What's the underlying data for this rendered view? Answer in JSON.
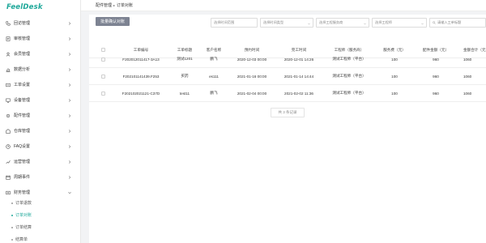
{
  "app": {
    "logo": "FeelDesk"
  },
  "sidebar": {
    "items": [
      {
        "label": "回访管理",
        "icon": "phone-icon"
      },
      {
        "label": "审核管理",
        "icon": "audit-icon"
      },
      {
        "label": "会员管理",
        "icon": "member-icon"
      },
      {
        "label": "数据分析",
        "icon": "chart-icon"
      },
      {
        "label": "工单设置",
        "icon": "ticket-settings-icon"
      },
      {
        "label": "设备管理",
        "icon": "device-icon"
      },
      {
        "label": "配件管理",
        "icon": "parts-icon"
      },
      {
        "label": "仓库管理",
        "icon": "warehouse-icon"
      },
      {
        "label": "FAQ设置",
        "icon": "faq-icon"
      },
      {
        "label": "运营管理",
        "icon": "operations-icon"
      },
      {
        "label": "周期事件",
        "icon": "calendar-icon"
      },
      {
        "label": "财务管理",
        "icon": "finance-icon"
      }
    ],
    "sub_items": [
      {
        "label": "订单退款"
      },
      {
        "label": "订单对账"
      },
      {
        "label": "订单结算"
      },
      {
        "label": "结算单"
      }
    ]
  },
  "breadcrumb": {
    "parent": "配件管理",
    "separator": "▸",
    "current": "订单对账"
  },
  "toolbar": {
    "batch_button": "批量确认对账",
    "filters": [
      {
        "placeholder": "选择时间范围"
      },
      {
        "placeholder": "选择时间类型"
      },
      {
        "placeholder": "选择工程服务商"
      },
      {
        "placeholder": "选择工程师"
      },
      {
        "placeholder": "请输入工单标题"
      }
    ]
  },
  "table": {
    "headers": [
      "工单编号",
      "工单标题",
      "客户名称",
      "预约时间",
      "完工时间",
      "工程师（服务商）",
      "服务费（元）",
      "配件金额（元）",
      "金额合计（元）"
    ],
    "rows": [
      [
        "F2020120114​17-3A13",
        "测试1201",
        "鹏飞",
        "2020-12-03 00:00",
        "2020-12-01 14:26",
        "测试工程师（平台）",
        "100",
        "960",
        "1060"
      ],
      [
        "F202101141439.F253",
        "买药",
        "es111",
        "2021-01-16 00:00",
        "2021-01-14 14:44",
        "测试工程师（平台）",
        "100",
        "960",
        "1060"
      ],
      [
        "F202102021121-C37D",
        "test11",
        "鹏飞",
        "2021-02-04 00:00",
        "2021-02-02 11:36",
        "测试工程师（平台）",
        "100",
        "960",
        "1060"
      ]
    ]
  },
  "pagination": {
    "summary": "共 3 条记录"
  },
  "colors": {
    "brand": "#1fa89a",
    "button": "#7d8392"
  }
}
